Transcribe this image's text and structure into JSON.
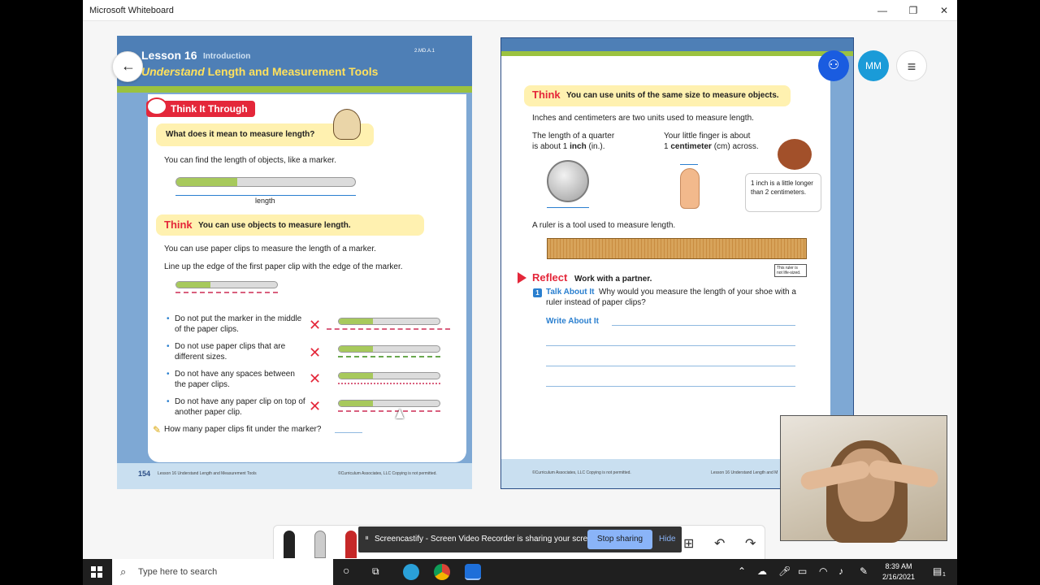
{
  "window": {
    "title": "Microsoft Whiteboard",
    "minimize": "—",
    "maximize": "❐",
    "close": "✕"
  },
  "left_page": {
    "lesson_number": "Lesson 16",
    "lesson_type": "Introduction",
    "standard": "2.MD.A.1",
    "title_em": "Understand",
    "title_rest": " Length and Measurement Tools",
    "banner": "Think It Through",
    "question": "What does it mean to measure length?",
    "line1": "You can find the length of objects, like a marker.",
    "length_label": "length",
    "think_word": "Think",
    "think_text": "You can use objects to measure length.",
    "line2": "You can use paper clips to measure the length of a marker.",
    "line3": "Line up the edge of the first paper clip with the edge of the marker.",
    "bullets": [
      "Do not put the marker in the middle of the paper clips.",
      "Do not use paper clips that are different sizes.",
      "Do not have any spaces between the paper clips.",
      "Do not have any paper clip on top of another paper clip."
    ],
    "prompt": "How many paper clips fit under the marker?",
    "page_number": "154",
    "footer_lesson": "Lesson 16  Understand Length and Measurement Tools",
    "footer_copy": "©Curriculum Associates, LLC   Copying is not permitted."
  },
  "right_page": {
    "think_word": "Think",
    "think_text": "You can use units of the same size to measure objects.",
    "intro": "Inches and centimeters are two units used to measure length.",
    "quarter_1": "The length of a quarter",
    "quarter_2a": "is about 1 ",
    "quarter_2b": "inch",
    "quarter_2c": " (in.).",
    "finger_1": "Your little finger is about",
    "finger_2a": "1 ",
    "finger_2b": "centimeter",
    "finger_2c": " (cm) across.",
    "note": "1 inch is a little longer than 2 centimeters.",
    "ruler_text": "A ruler is a tool used to measure length.",
    "life_note": "This ruler is not life-sized.",
    "reflect_word": "Reflect",
    "reflect_text": "Work with a partner.",
    "item_number": "1",
    "talk_about": "Talk About It",
    "talk_text": "Why would you measure the length of your shoe with a ruler instead of paper clips?",
    "write_about": "Write About It",
    "footer_copy": "©Curriculum Associates, LLC   Copying is not permitted.",
    "footer_lesson": "Lesson 16  Understand Length and M"
  },
  "controls": {
    "back_icon": "←",
    "avatar_initials": "MM",
    "menu_icon": "≡",
    "share_icon": "⚇"
  },
  "screencastify": {
    "message": "Screencastify - Screen Video Recorder is sharing your screen.",
    "stop": "Stop sharing",
    "hide": "Hide"
  },
  "toolbar_icons": {
    "add": "⊞",
    "undo": "↶",
    "redo": "↷"
  },
  "taskbar": {
    "search_placeholder": "Type here to search",
    "time": "8:39 AM",
    "date": "2/16/2021",
    "notif_count": "1"
  },
  "colors": {
    "accent_red": "#e4273a",
    "blue": "#4e7fb6",
    "green": "#9bc23f",
    "share_blue": "#1a5ce0",
    "avatar_teal": "#1a9bd8"
  }
}
